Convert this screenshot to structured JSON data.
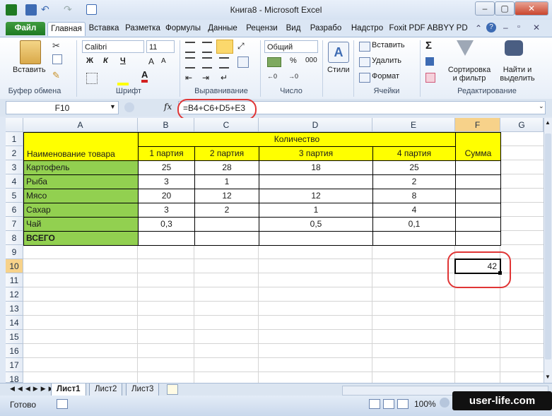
{
  "window": {
    "title": "Книга8 - Microsoft Excel"
  },
  "tabs": [
    "Файл",
    "Главная",
    "Вставка",
    "Разметка",
    "Формулы",
    "Данные",
    "Рецензи",
    "Вид",
    "Разрабо",
    "Надстро",
    "Foxit PDF",
    "ABBYY PD"
  ],
  "active_tab": "Главная",
  "ribbon": {
    "clipboard": {
      "paste_label": "Вставить",
      "group_label": "Буфер обмена"
    },
    "font": {
      "name": "Calibri",
      "size": "11",
      "group_label": "Шрифт",
      "bold": "Ж",
      "italic": "К",
      "underline": "Ч",
      "grow": "A",
      "shrink": "A"
    },
    "alignment": {
      "group_label": "Выравнивание"
    },
    "number": {
      "format": "Общий",
      "group_label": "Число",
      "percent": "%",
      "thousands": "000"
    },
    "styles": {
      "label": "Стили"
    },
    "cells": {
      "insert": "Вставить",
      "delete": "Удалить",
      "format": "Формат",
      "group_label": "Ячейки"
    },
    "editing": {
      "sum": "Σ",
      "sort": "Сортировка и фильтр",
      "find": "Найти и выделить",
      "group_label": "Редактирование"
    }
  },
  "formula_bar": {
    "name_box": "F10",
    "fx": "fx",
    "formula": "=B4+C6+D5+E3"
  },
  "columns": [
    "A",
    "B",
    "C",
    "D",
    "E",
    "F",
    "G"
  ],
  "rows": [
    "1",
    "2",
    "3",
    "4",
    "5",
    "6",
    "7",
    "8",
    "9",
    "10",
    "11",
    "12",
    "13",
    "14",
    "15",
    "16",
    "17",
    "18"
  ],
  "table": {
    "header_group": "Количество",
    "name_header": "Наименование товара",
    "batches": [
      "1 партия",
      "2 партия",
      "3 партия",
      "4 партия"
    ],
    "sum_header": "Сумма",
    "items": [
      {
        "name": "Картофель",
        "b": "25",
        "c": "28",
        "d": "18",
        "e": "25"
      },
      {
        "name": "Рыба",
        "b": "3",
        "c": "1",
        "d": "",
        "e": "2"
      },
      {
        "name": "Мясо",
        "b": "20",
        "c": "12",
        "d": "12",
        "e": "8"
      },
      {
        "name": "Сахар",
        "b": "3",
        "c": "2",
        "d": "1",
        "e": "4"
      },
      {
        "name": "Чай",
        "b": "0,3",
        "c": "",
        "d": "0,5",
        "e": "0,1"
      },
      {
        "name": "ВСЕГО",
        "b": "",
        "c": "",
        "d": "",
        "e": ""
      }
    ],
    "result_value": "42"
  },
  "sheets": [
    "Лист1",
    "Лист2",
    "Лист3"
  ],
  "active_sheet": "Лист1",
  "status": {
    "ready": "Готово",
    "zoom": "100%"
  },
  "watermark": "user-life.com",
  "colors": {
    "yellow": "#ffff00",
    "green": "#92d050",
    "highlight": "#e03535"
  }
}
